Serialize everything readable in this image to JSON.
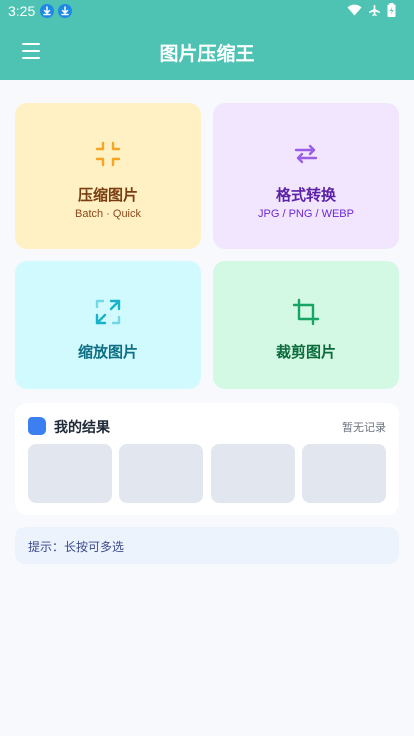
{
  "status_bar": {
    "time": "3:25"
  },
  "app_bar": {
    "title": "图片压缩王"
  },
  "cards": [
    {
      "title": "压缩图片",
      "subtitle": "Batch · Quick",
      "color": "#fff1c4",
      "icon": "compress-icon"
    },
    {
      "title": "格式转换",
      "subtitle": "JPG / PNG / WEBP",
      "color": "#f2e6ff",
      "icon": "convert-icon"
    },
    {
      "title": "缩放图片",
      "subtitle": "",
      "color": "#d1fafe",
      "icon": "resize-icon"
    },
    {
      "title": "裁剪图片",
      "subtitle": "",
      "color": "#d3f8e3",
      "icon": "crop-icon"
    }
  ],
  "results": {
    "title": "我的结果",
    "empty_label": "暂无记录"
  },
  "tip": {
    "text": "提示：长按可多选"
  },
  "colors": {
    "accent": "#4fc3b3",
    "results_icon": "#3b7ff0"
  }
}
